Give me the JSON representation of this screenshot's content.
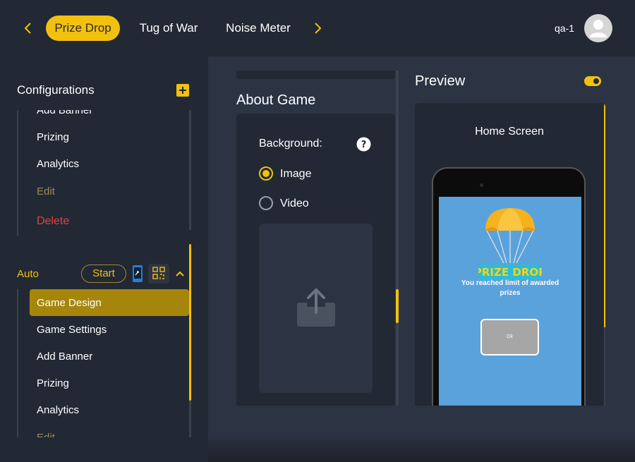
{
  "header": {
    "tabs": [
      {
        "label": "Prize Drop",
        "active": true
      },
      {
        "label": "Tug of War",
        "active": false
      },
      {
        "label": "Noise Meter",
        "active": false
      }
    ],
    "user": "qa-1"
  },
  "sidebar": {
    "title": "Configurations",
    "group1_items": [
      {
        "label": "Add Banner"
      },
      {
        "label": "Prizing"
      },
      {
        "label": "Analytics"
      },
      {
        "label": "Edit"
      },
      {
        "label": "Delete"
      }
    ],
    "group2": {
      "label": "Auto",
      "start_label": "Start",
      "items": [
        {
          "label": "Game Design",
          "active": true
        },
        {
          "label": "Game Settings"
        },
        {
          "label": "Add Banner"
        },
        {
          "label": "Prizing"
        },
        {
          "label": "Analytics"
        },
        {
          "label": "Edit"
        }
      ]
    }
  },
  "about": {
    "title": "About Game",
    "background_label": "Background:",
    "options": [
      {
        "label": "Image",
        "selected": true
      },
      {
        "label": "Video",
        "selected": false
      }
    ]
  },
  "preview": {
    "title": "Preview",
    "toggle_on": true,
    "screen_label": "Home Screen",
    "logo_text": "PRIZE DROP",
    "message": "You reached limit of awarded prizes",
    "ok_label": "Ok"
  },
  "colors": {
    "accent": "#f2c10f",
    "background": "#222834",
    "panel": "#2c3343",
    "danger": "#e2453c",
    "phone_screen": "#5aa2dc"
  }
}
